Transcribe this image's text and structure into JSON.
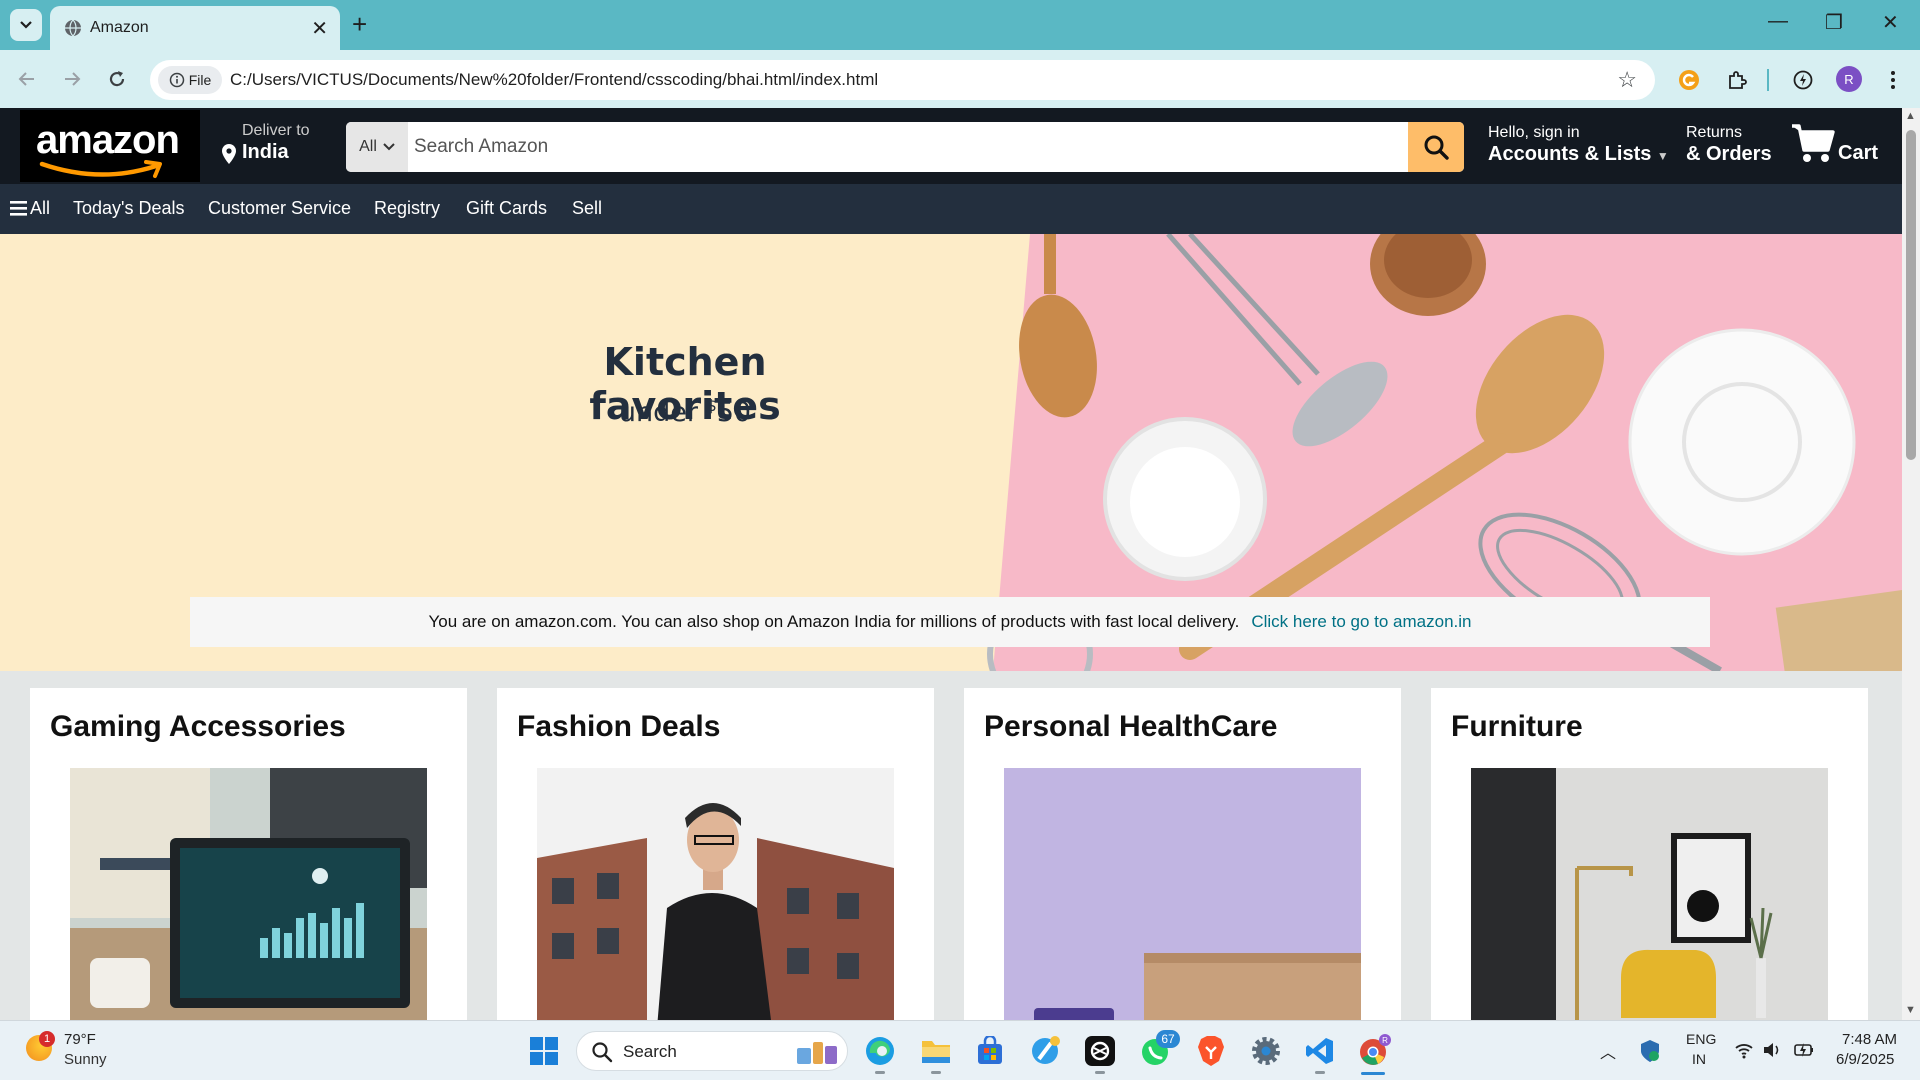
{
  "browser": {
    "tab_title": "Amazon",
    "new_tab": "+",
    "url_chip": "File",
    "url": "C:/Users/VICTUS/Documents/New%20folder/Frontend/csscoding/bhai.html/index.html",
    "profile_initial": "R"
  },
  "header": {
    "logo_text": "amazon",
    "deliver_line1": "Deliver to",
    "deliver_line2": "India",
    "search_category": "All",
    "search_placeholder": "Search Amazon",
    "account_line1": "Hello, sign in",
    "account_line2": "Accounts & Lists",
    "returns_line1": "Returns",
    "returns_line2": "& Orders",
    "cart_label": "Cart"
  },
  "subnav": {
    "items": [
      "All",
      "Today's Deals",
      "Customer Service",
      "Registry",
      "Gift Cards",
      "Sell"
    ]
  },
  "hero": {
    "title": "Kitchen favorites",
    "subtitle_prefix": "under ",
    "subtitle_currency": "$",
    "subtitle_amount": "50",
    "notice_text": "You are on amazon.com. You can also shop on Amazon India for millions of products with fast local delivery.",
    "notice_link": "Click here to go to amazon.in"
  },
  "cards": [
    {
      "title": "Gaming Accessories"
    },
    {
      "title": "Fashion Deals"
    },
    {
      "title": "Personal HealthCare"
    },
    {
      "title": "Furniture"
    }
  ],
  "taskbar": {
    "weather_temp": "79°F",
    "weather_desc": "Sunny",
    "weather_badge": "1",
    "search_label": "Search",
    "whatsapp_badge": "67",
    "lang_line1": "ENG",
    "lang_line2": "IN",
    "time": "7:48 AM",
    "date": "6/9/2025"
  },
  "colors": {
    "tabstrip": "#5ab8c4",
    "amazon_header": "#131921",
    "amazon_subnav": "#232f3e",
    "search_button": "#febd69",
    "hero_bg": "#fdecc8",
    "hero_pink": "#f7b9c8",
    "link": "#007185"
  }
}
